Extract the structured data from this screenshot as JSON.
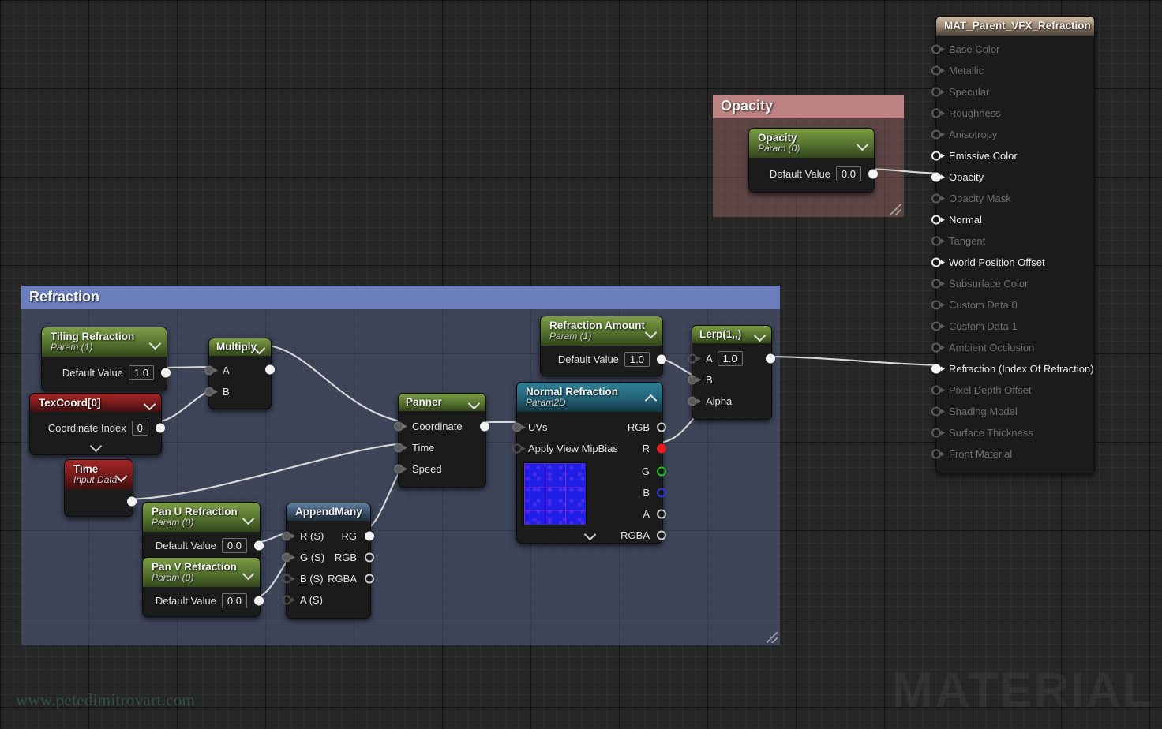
{
  "watermarks": {
    "site": "www.petedimitrovart.com",
    "label": "MATERIAL"
  },
  "comments": [
    {
      "id": "opacity",
      "title": "Opacity",
      "color": "#bd8383"
    },
    {
      "id": "refraction",
      "title": "Refraction",
      "color": "#6b7fbe"
    }
  ],
  "material_node": {
    "title": "MAT_Parent_VFX_Refraction",
    "inputs": [
      {
        "label": "Base Color",
        "enabled": false,
        "connected": false
      },
      {
        "label": "Metallic",
        "enabled": false,
        "connected": false
      },
      {
        "label": "Specular",
        "enabled": false,
        "connected": false
      },
      {
        "label": "Roughness",
        "enabled": false,
        "connected": false
      },
      {
        "label": "Anisotropy",
        "enabled": false,
        "connected": false
      },
      {
        "label": "Emissive Color",
        "enabled": true,
        "connected": false
      },
      {
        "label": "Opacity",
        "enabled": true,
        "connected": true
      },
      {
        "label": "Opacity Mask",
        "enabled": false,
        "connected": false
      },
      {
        "label": "Normal",
        "enabled": true,
        "connected": false
      },
      {
        "label": "Tangent",
        "enabled": false,
        "connected": false
      },
      {
        "label": "World Position Offset",
        "enabled": true,
        "connected": false
      },
      {
        "label": "Subsurface Color",
        "enabled": false,
        "connected": false
      },
      {
        "label": "Custom Data 0",
        "enabled": false,
        "connected": false
      },
      {
        "label": "Custom Data 1",
        "enabled": false,
        "connected": false
      },
      {
        "label": "Ambient Occlusion",
        "enabled": false,
        "connected": false
      },
      {
        "label": "Refraction (Index Of Refraction)",
        "enabled": true,
        "connected": true
      },
      {
        "label": "Pixel Depth Offset",
        "enabled": false,
        "connected": false
      },
      {
        "label": "Shading Model",
        "enabled": false,
        "connected": false
      },
      {
        "label": "Surface Thickness",
        "enabled": false,
        "connected": false
      },
      {
        "label": "Front Material",
        "enabled": false,
        "connected": false
      }
    ]
  },
  "nodes": {
    "opacity_param": {
      "title": "Opacity",
      "subtitle": "Param (0)",
      "default_value_label": "Default Value",
      "default_value": "0.0"
    },
    "tiling_refraction": {
      "title": "Tiling Refraction",
      "subtitle": "Param (1)",
      "default_value_label": "Default Value",
      "default_value": "1.0"
    },
    "texcoord": {
      "title": "TexCoord[0]",
      "coordinate_index_label": "Coordinate Index",
      "coordinate_index": "0"
    },
    "time": {
      "title": "Time",
      "subtitle": "Input Data"
    },
    "multiply": {
      "title": "Multiply",
      "input_a": "A",
      "input_b": "B"
    },
    "pan_u_refraction": {
      "title": "Pan U Refraction",
      "subtitle": "Param (0)",
      "default_value_label": "Default Value",
      "default_value": "0.0"
    },
    "pan_v_refraction": {
      "title": "Pan V Refraction",
      "subtitle": "Param (0)",
      "default_value_label": "Default Value",
      "default_value": "0.0"
    },
    "append_many": {
      "title": "AppendMany",
      "inputs": [
        "R (S)",
        "G (S)",
        "B (S)",
        "A (S)"
      ],
      "outputs": [
        "RG",
        "RGB",
        "RGBA"
      ]
    },
    "panner": {
      "title": "Panner",
      "inputs": [
        "Coordinate",
        "Time",
        "Speed"
      ]
    },
    "normal_refraction": {
      "title": "Normal Refraction",
      "subtitle": "Param2D",
      "inputs": [
        "UVs",
        "Apply View MipBias"
      ],
      "outputs": [
        "RGB",
        "R",
        "G",
        "B",
        "A",
        "RGBA"
      ]
    },
    "refraction_amount": {
      "title": "Refraction Amount",
      "subtitle": "Param (1)",
      "default_value_label": "Default Value",
      "default_value": "1.0"
    },
    "lerp": {
      "title": "Lerp(1,,)",
      "input_a_label": "A",
      "input_a_value": "1.0",
      "input_b": "B",
      "input_alpha": "Alpha"
    }
  }
}
